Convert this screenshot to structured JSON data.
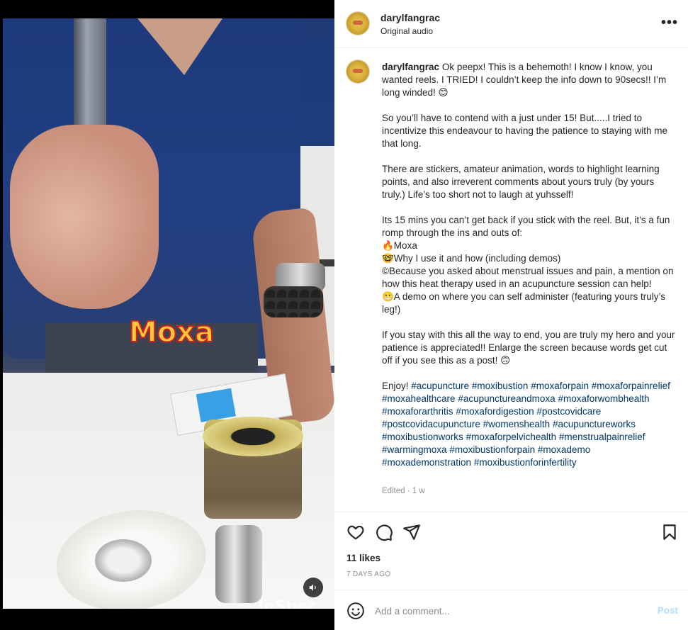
{
  "media": {
    "overlay_caption": "Moxa",
    "watermark": "InShot",
    "audio_icon": "speaker-icon"
  },
  "header": {
    "username": "darylfangrac",
    "subtitle": "Original audio",
    "more_icon": "more-horizontal-icon",
    "more_label": "•••"
  },
  "caption": {
    "username": "darylfangrac",
    "paragraphs": [
      [
        "Ok peepx! This is a behemoth! I know I know, you wanted reels. I TRIED! I couldn’t keep the info down to 90secs!! I’m long winded! 😊"
      ],
      [
        "So you’ll have to contend with a just under 15! But.....I tried to incentivize this endeavour to having the patience to staying with me that long."
      ],
      [
        "There are stickers, amateur animation, words to highlight learning points, and also irreverent comments about yours truly (by yours truly.) Life’s too short not to laugh at yuhsself!"
      ],
      [
        "Its 15 mins you can’t get back if you stick with the reel. But, it’s a fun romp through the ins and outs of:",
        "🔥Moxa",
        "🤓Why I use it and how (including demos)",
        "©Because you asked about menstrual issues and pain, a mention on how this heat therapy used in an acupuncture session can help!",
        "😬A demo on where you can self administer (featuring yours truly’s leg!)"
      ],
      [
        "If you stay with this all the way to end, you are truly my hero and your patience is appreciated!! Enlarge the screen because words get cut off if you see this as a post! 🙃"
      ]
    ],
    "enjoy": "Enjoy!",
    "hashtags": [
      "#acupuncture",
      "#moxibustion",
      "#moxaforpain",
      "#moxaforpainrelief",
      "#moxahealthcare",
      "#acupunctureandmoxa",
      "#moxaforwombhealth",
      "#moxaforarthritis",
      "#moxafordigestion",
      "#postcovidcare",
      "#postcovidacupuncture",
      "#womenshealth",
      "#acupunctureworks",
      "#moxibustionworks",
      "#moxaforpelvichealth",
      "#menstrualpainrelief",
      "#warmingmoxa",
      "#moxibustionforpain",
      "#moxademo",
      "#moxademonstration",
      "#moxibustionforinfertility"
    ],
    "edited": "Edited · 1 w"
  },
  "actions": {
    "like_icon": "heart-icon",
    "comment_icon": "comment-icon",
    "share_icon": "paper-plane-icon",
    "save_icon": "bookmark-icon"
  },
  "likes": "11 likes",
  "date": "7 DAYS AGO",
  "comment": {
    "emoji_icon": "emoji-icon",
    "placeholder": "Add a comment...",
    "post_label": "Post"
  },
  "colors": {
    "hashtag": "#00376b",
    "muted": "#8e8e8e",
    "post_disabled": "#b2dffc",
    "text": "#262626"
  }
}
